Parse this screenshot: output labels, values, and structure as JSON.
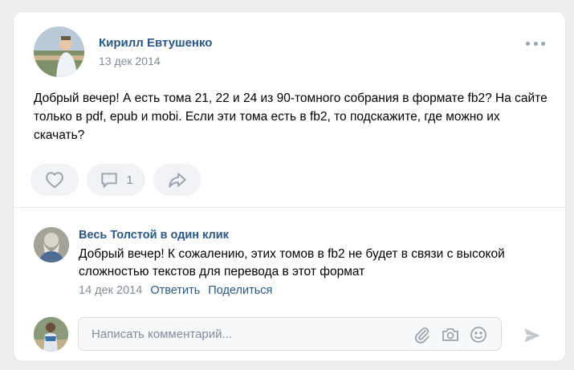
{
  "post": {
    "author_name": "Кирилл Евтушенко",
    "date": "13 дек 2014",
    "text": "Добрый вечер! А есть тома 21, 22 и 24 из 90-томного собрания в формате fb2? На сайте только в pdf, epub и mobi. Если эти тома есть в fb2, то подскажите, где можно их скачать?",
    "more_icon": "more-horizontal-icon"
  },
  "actions": {
    "like_icon": "heart-icon",
    "comment_icon": "comment-icon",
    "comment_count": "1",
    "share_icon": "share-icon"
  },
  "comment": {
    "author_name": "Весь Толстой в один клик",
    "text": "Добрый вечер! К сожалению, этих томов в fb2 не будет в связи с высокой сложностью текстов для перевода в этот формат",
    "date": "14 дек 2014",
    "reply_label": "Ответить",
    "share_label": "Поделиться"
  },
  "composer": {
    "placeholder": "Написать комментарий...",
    "value": "",
    "icons": [
      "paperclip-icon",
      "camera-icon",
      "smile-icon",
      "send-icon"
    ]
  },
  "colors": {
    "link": "#2a5885",
    "secondary_text": "#818c99",
    "icon": "#99a2ad",
    "button_bg": "#f0f2f5",
    "page_bg": "#edeef0"
  }
}
